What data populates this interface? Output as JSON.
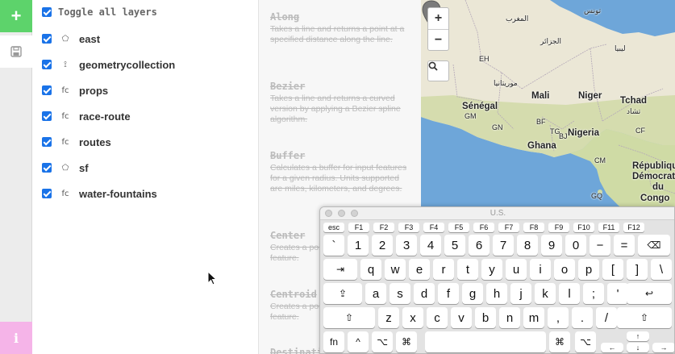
{
  "rail": {
    "add_label": "+",
    "info_label": "i"
  },
  "layers": {
    "toggle_all_label": "Toggle all layers",
    "items": [
      {
        "name": "east",
        "type_icon": "polygon-icon",
        "type_glyph": "⬠"
      },
      {
        "name": "geometrycollection",
        "type_icon": "geometry-collection-icon",
        "type_glyph": "⟟"
      },
      {
        "name": "props",
        "type_icon": "feature-collection-icon",
        "type_glyph": "fc"
      },
      {
        "name": "race-route",
        "type_icon": "feature-collection-icon",
        "type_glyph": "fc"
      },
      {
        "name": "routes",
        "type_icon": "feature-collection-icon",
        "type_glyph": "fc"
      },
      {
        "name": "sf",
        "type_icon": "polygon-icon",
        "type_glyph": "⬠"
      },
      {
        "name": "water-fountains",
        "type_icon": "feature-collection-icon",
        "type_glyph": "fc"
      }
    ]
  },
  "functions": [
    {
      "title": "Along",
      "desc": "Takes a line and returns a point at a specified distance along the line."
    },
    {
      "title": "Bezier",
      "desc": "Takes a line and returns a curved version by applying a Bezier spline algorithm."
    },
    {
      "title": "Buffer",
      "desc": "Calculates a buffer for input features for a given radius. Units supported are miles, kilometers, and degrees."
    },
    {
      "title": "Center",
      "desc": "Creates a point in the center of the feature."
    },
    {
      "title": "Centroid",
      "desc": "Creates a point in the center of the feature."
    },
    {
      "title": "Destination",
      "desc": ""
    }
  ],
  "map": {
    "zoom_in": "+",
    "zoom_out": "−",
    "labels": {
      "tunisia": "تونس",
      "morocco": "المغرب",
      "algeria": "الجزائر",
      "libya": "ليبيا",
      "mauritania": "موريتانيا",
      "mali": "Mali",
      "niger": "Niger",
      "chad": "Tchad",
      "chad_ar": "تشاد",
      "senegal": "Sénégal",
      "gm": "GM",
      "gn": "GN",
      "bf": "BF",
      "bj": "BJ",
      "tg": "TG",
      "ng": "Nigeria",
      "ghana": "Ghana",
      "eh": "EH",
      "gq": "GQ",
      "cm": "CM",
      "cf": "CF",
      "drc1": "République",
      "drc2": "Démocratique",
      "drc3": "du",
      "drc4": "Congo"
    },
    "colors": {
      "water": "#6ea6d9",
      "land": "#e9e7d9",
      "desert": "#efe9d5",
      "green": "#c9d8a3"
    }
  },
  "keyboard": {
    "title": "U.S.",
    "fn_row": [
      "esc",
      "F1",
      "F2",
      "F3",
      "F4",
      "F5",
      "F6",
      "F7",
      "F8",
      "F9",
      "F10",
      "F11",
      "F12"
    ],
    "num_row": [
      "`",
      "1",
      "2",
      "3",
      "4",
      "5",
      "6",
      "7",
      "8",
      "9",
      "0",
      "−",
      "=",
      "⌫"
    ],
    "top_row": [
      "⇥",
      "q",
      "w",
      "e",
      "r",
      "t",
      "y",
      "u",
      "i",
      "o",
      "p",
      "[",
      "]",
      "\\"
    ],
    "home_row": [
      "⇪",
      "a",
      "s",
      "d",
      "f",
      "g",
      "h",
      "j",
      "k",
      "l",
      ";",
      "'",
      "↩"
    ],
    "bottom_row": [
      "⇧",
      "z",
      "x",
      "c",
      "v",
      "b",
      "n",
      "m",
      ",",
      ".",
      "/",
      "⇧"
    ],
    "mod_row": [
      "fn",
      "^",
      "⌥",
      "⌘",
      "",
      "⌘",
      "⌥"
    ],
    "arrows": {
      "up": "↑",
      "left": "←",
      "down": "↓",
      "right": "→"
    }
  }
}
